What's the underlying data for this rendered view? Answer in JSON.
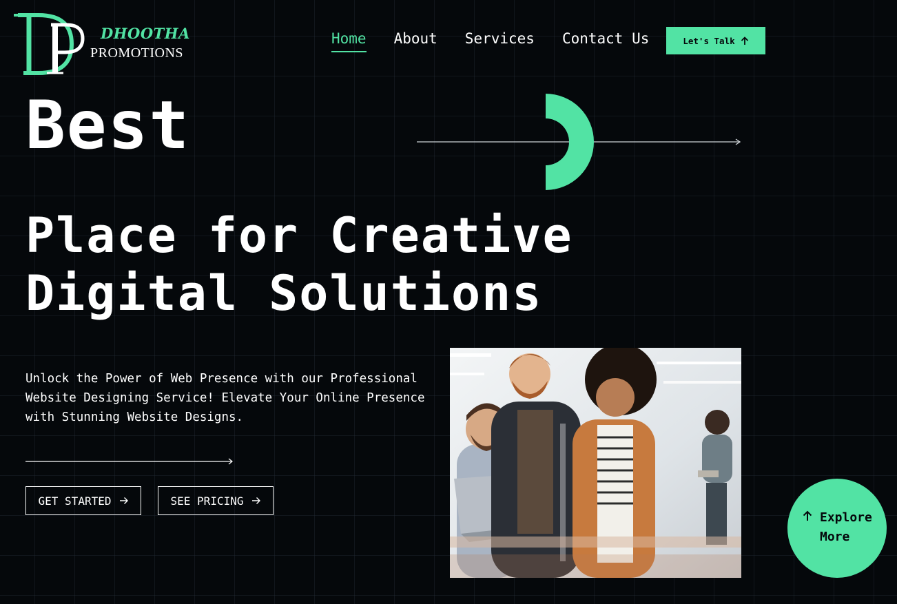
{
  "brand": {
    "monogram": "DP",
    "name_line1": "DHOOTHA",
    "name_line2": "PROMOTIONS",
    "accent": "#52e3a4",
    "background": "#05080b"
  },
  "nav": {
    "items": [
      {
        "label": "Home",
        "active": true
      },
      {
        "label": "About",
        "active": false
      },
      {
        "label": "Services",
        "active": false
      },
      {
        "label": "Contact Us",
        "active": false
      }
    ],
    "cta_label": "Let's Talk",
    "cta_icon": "arrow-up-icon"
  },
  "hero": {
    "headline_1": "Best",
    "headline_2": "Place for Creative Digital Solutions",
    "description": "Unlock the Power of Web Presence with our Professional Website Designing Service! Elevate Your Online Presence with Stunning Website Designs.",
    "primary_button": "GET STARTED",
    "secondary_button": "SEE PRICING",
    "button_icon": "arrow-right-icon"
  },
  "explore": {
    "line1": "Explore",
    "line2": "More",
    "icon": "arrow-up-icon"
  }
}
